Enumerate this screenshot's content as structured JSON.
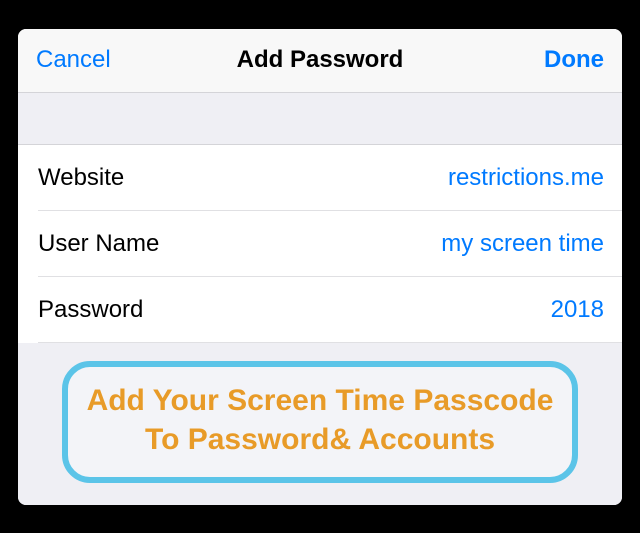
{
  "nav": {
    "cancel": "Cancel",
    "title": "Add Password",
    "done": "Done"
  },
  "form": {
    "website": {
      "label": "Website",
      "value": "restrictions.me"
    },
    "username": {
      "label": "User Name",
      "value": "my screen time"
    },
    "password": {
      "label": "Password",
      "value": "2018"
    }
  },
  "callout": {
    "text": "Add Your Screen Time Passcode To Password& Accounts"
  }
}
